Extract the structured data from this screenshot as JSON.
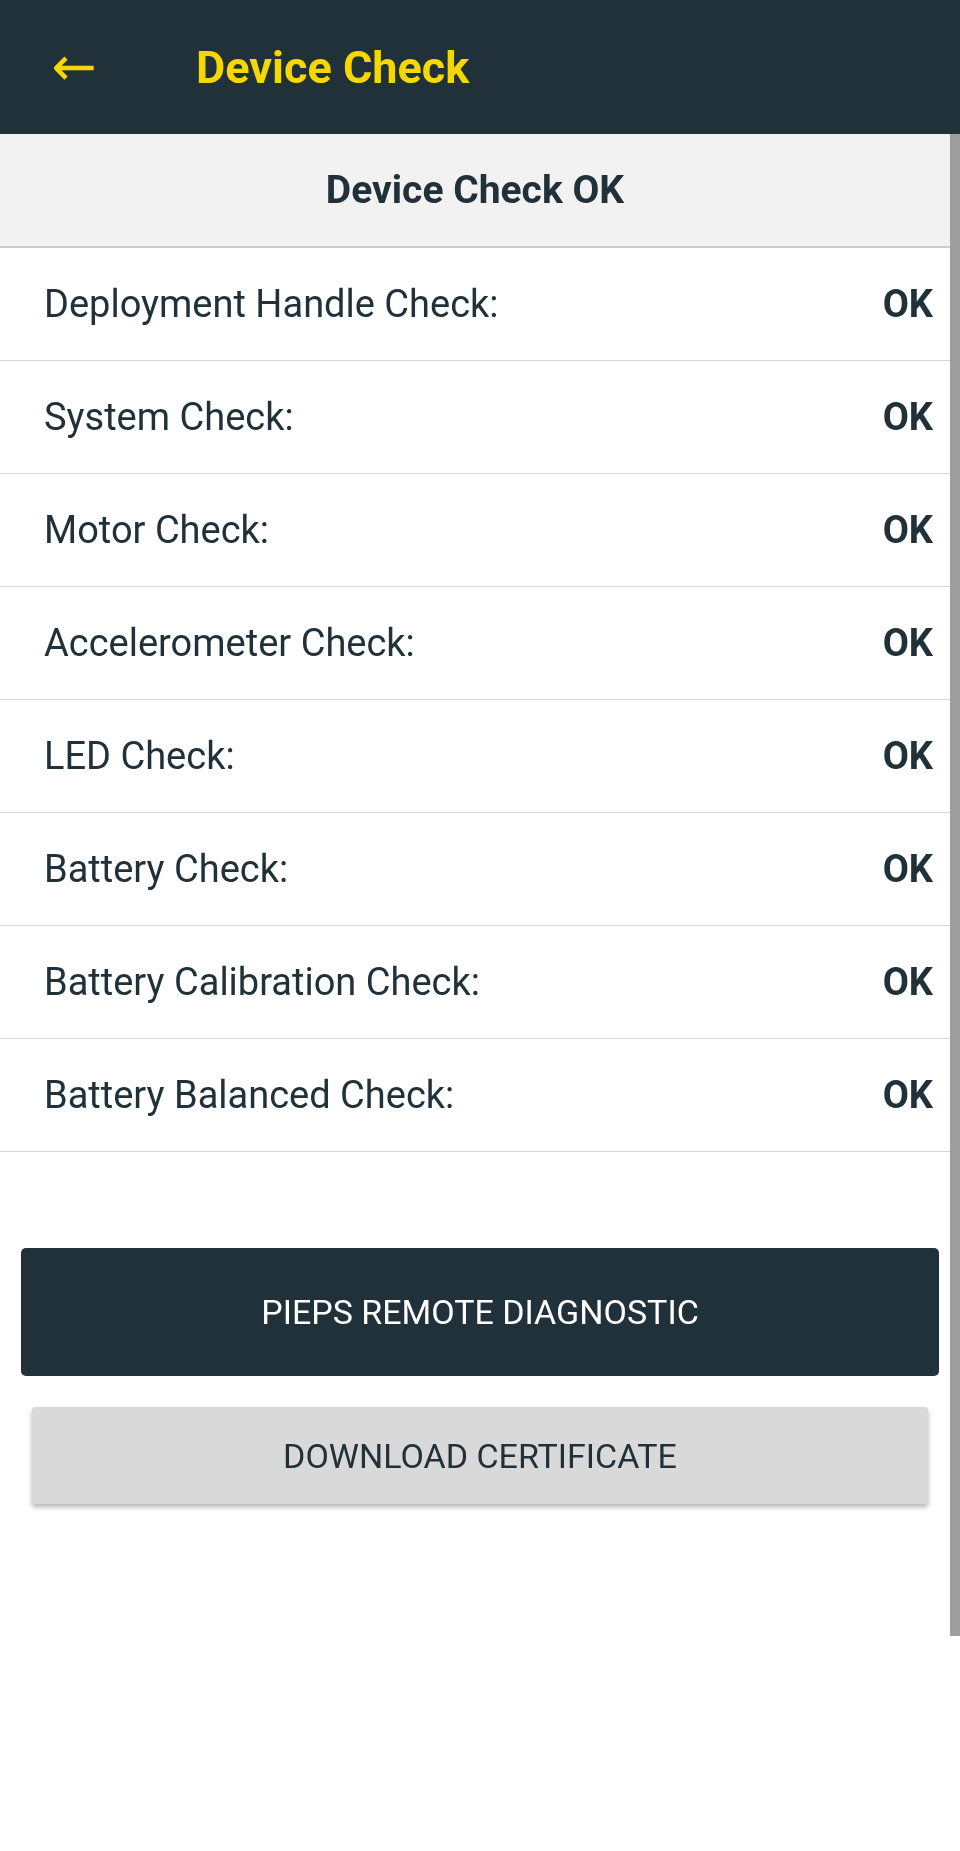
{
  "app_bar": {
    "back_icon": "←",
    "title": "Device Check"
  },
  "summary": "Device Check OK",
  "checks": [
    {
      "label": "Deployment Handle Check:",
      "result": "OK"
    },
    {
      "label": "System Check:",
      "result": "OK"
    },
    {
      "label": "Motor Check:",
      "result": "OK"
    },
    {
      "label": "Accelerometer Check:",
      "result": "OK"
    },
    {
      "label": "LED Check:",
      "result": "OK"
    },
    {
      "label": "Battery Check:",
      "result": "OK"
    },
    {
      "label": "Battery Calibration Check:",
      "result": "OK"
    },
    {
      "label": "Battery Balanced Check:",
      "result": "OK"
    }
  ],
  "buttons": [
    {
      "label": "PIEPS REMOTE DIAGNOSTIC",
      "kind": "primary"
    },
    {
      "label": "DOWNLOAD CERTIFICATE",
      "kind": "secondary"
    }
  ]
}
